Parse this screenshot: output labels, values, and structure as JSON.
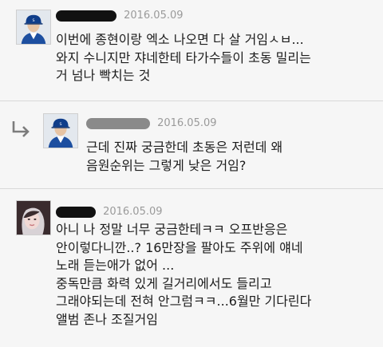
{
  "comments": [
    {
      "date": "2016.05.09",
      "text": "이번에 종현이랑 엑소 나오면 다 살 거임ㅅㅂ...\n와지 수니지만 쟈네한테 타가수들이 초동 밀리는\n거 넘나 빡치는 것"
    },
    {
      "date": "2016.05.09",
      "text": "근데 진짜 궁금한데 초동은 저런데 왜\n음원순위는 그렇게 낮은 거임?"
    },
    {
      "date": "2016.05.09",
      "text": "아니 나 정말 너무 궁금한테ㅋㅋ 오프반응은\n안이렇다니깐..? 16만장을 팔아도 주위에 얘네\n노래 듣는애가 없어 ...\n중독만큼 화력 있게 길거리에서도 들리고\n그래야되는데 전혀 안그럼ㅋㅋ...6월만 기다린다\n앨범 존나 조질거임"
    }
  ],
  "icons": {
    "reply": "reply-arrow-icon",
    "avatar_baseball": "baseball-player-avatar",
    "avatar_girl": "user-avatar"
  },
  "colors": {
    "background": "#f6f6f6",
    "date": "#9a9a9a",
    "divider": "#d9d9d9",
    "redaction": "#111111"
  }
}
